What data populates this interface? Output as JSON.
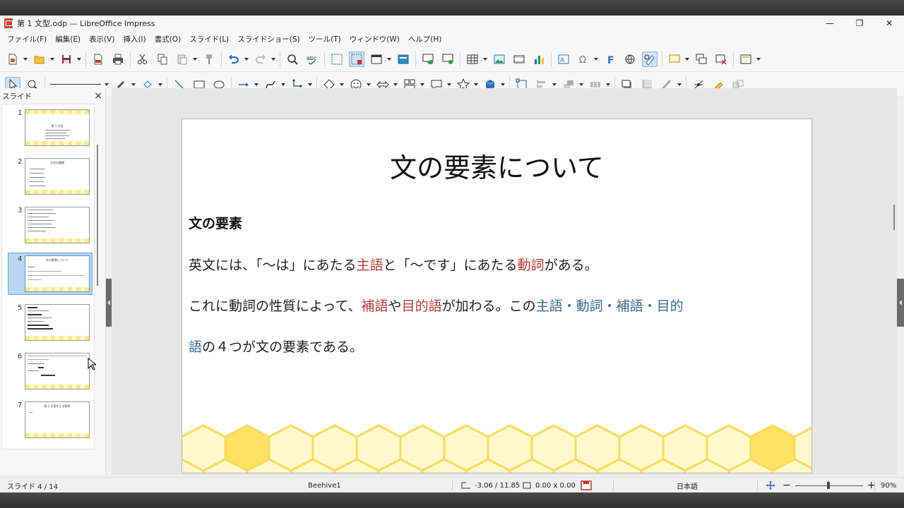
{
  "window": {
    "title": "第 1 文型.odp — LibreOffice Impress",
    "controls": {
      "minimize": "—",
      "restore": "❐",
      "close": "✕"
    }
  },
  "menubar": [
    "ファイル(F)",
    "編集(E)",
    "表示(V)",
    "挿入(I)",
    "書式(O)",
    "スライド(L)",
    "スライドショー(S)",
    "ツール(T)",
    "ウィンドウ(W)",
    "ヘルプ(H)"
  ],
  "slide_pane": {
    "title": "スライド",
    "close": "×",
    "thumbnails": [
      {
        "number": "1",
        "title": "第 1 文型"
      },
      {
        "number": "2",
        "title": "文型の種類"
      },
      {
        "number": "3",
        "title": ""
      },
      {
        "number": "4",
        "title": "文の要素について",
        "active": true
      },
      {
        "number": "5",
        "title": ""
      },
      {
        "number": "6",
        "title": ""
      },
      {
        "number": "7",
        "title": "第 1 文型をとる動詞"
      }
    ]
  },
  "slide": {
    "title": "文の要素について",
    "heading": "文の要素",
    "p1": {
      "a": "英文には、「〜は」にあたる",
      "b": "主語",
      "c": "と「〜です」にあたる",
      "d": "動詞",
      "e": "がある。"
    },
    "p2": {
      "a": "これに動詞の性質によって、",
      "b": "補語",
      "c": "や",
      "d": "目的語",
      "e": "が加わる。この",
      "f": "主語・動詞・補語・目的"
    },
    "p3": {
      "a": "語",
      "b": "の４つが文の要素である。"
    },
    "colors": {
      "red": "#b33a3a",
      "blue": "#3a6b8c",
      "hex_dark": "#fbe264",
      "hex_light": "#fff8cc"
    }
  },
  "statusbar": {
    "slide": "スライド 4 / 14",
    "master": "Beehive1",
    "position": "-3.06 / 11.85",
    "size": "0.00 x 0.00",
    "language": "日本語",
    "zoom_minus": "−",
    "zoom_plus": "+",
    "zoom": "90%"
  }
}
